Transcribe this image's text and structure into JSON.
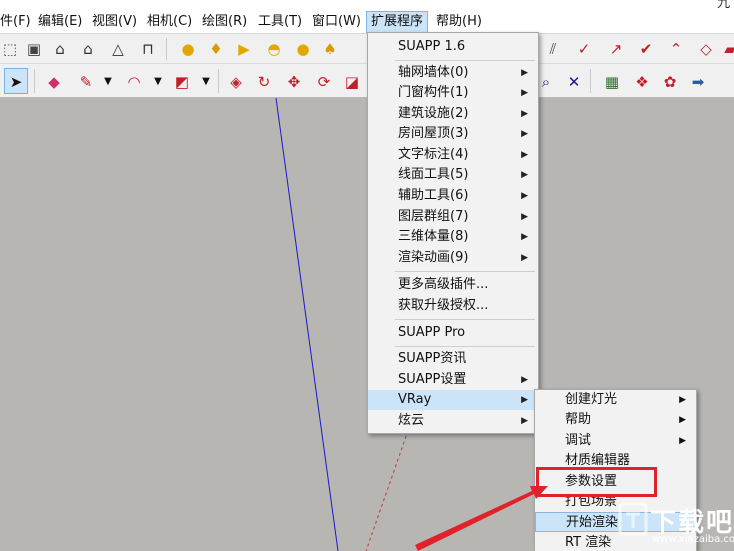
{
  "title": {
    "fragment": "九"
  },
  "menubar": {
    "items": [
      {
        "label": "件(F)"
      },
      {
        "label": "编辑(E)"
      },
      {
        "label": "视图(V)"
      },
      {
        "label": "相机(C)"
      },
      {
        "label": "绘图(R)"
      },
      {
        "label": "工具(T)"
      },
      {
        "label": "窗口(W)"
      },
      {
        "label": "扩展程序"
      },
      {
        "label": "帮助(H)"
      }
    ]
  },
  "toolbar": {
    "icons": [
      "section-icon",
      "box-icon",
      "house-icon",
      "house-outline-icon",
      "roof-icon",
      "warehouse-icon",
      "sphere-icon",
      "spotlight-icon",
      "flag-icon",
      "dome-icon",
      "ball-icon",
      "lamp-icon",
      "select-arrow-icon",
      "eraser-icon",
      "pencil-icon",
      "arc-icon",
      "shape-icon",
      "push-pull-icon",
      "orbit-icon",
      "move-icon",
      "rotate-icon",
      "scale-icon"
    ]
  },
  "extension_menu": {
    "header": "SUAPP 1.6",
    "items": [
      {
        "label": "轴网墙体(0)",
        "submenu": true
      },
      {
        "label": "门窗构件(1)",
        "submenu": true
      },
      {
        "label": "建筑设施(2)",
        "submenu": true
      },
      {
        "label": "房间屋顶(3)",
        "submenu": true
      },
      {
        "label": "文字标注(4)",
        "submenu": true
      },
      {
        "label": "线面工具(5)",
        "submenu": true
      },
      {
        "label": "辅助工具(6)",
        "submenu": true
      },
      {
        "label": "图层群组(7)",
        "submenu": true
      },
      {
        "label": "三维体量(8)",
        "submenu": true
      },
      {
        "label": "渲染动画(9)",
        "submenu": true
      }
    ],
    "more_plugins": "更多高级插件...",
    "get_license": "获取升级授权...",
    "suapp_pro": "SUAPP Pro",
    "suapp_news": "SUAPP资讯",
    "suapp_settings": "SUAPP设置",
    "vray": "VRay",
    "xuanyun": "炫云"
  },
  "vray_menu": {
    "items": [
      {
        "label": "创建灯光",
        "submenu": true
      },
      {
        "label": "帮助",
        "submenu": true
      },
      {
        "label": "调试",
        "submenu": true
      },
      {
        "label": "材质编辑器",
        "submenu": false
      },
      {
        "label": "参数设置",
        "submenu": false
      },
      {
        "label": "打包场景",
        "submenu": false
      },
      {
        "label": "开始渲染",
        "submenu": false
      },
      {
        "label": "RT 渲染",
        "submenu": false
      }
    ]
  },
  "watermark": {
    "brand": "下载吧",
    "url": "www.xiazaiba.com"
  },
  "colors": {
    "highlight": "#cce4f7",
    "callout": "#e0222a",
    "canvas": "#b8b6b3",
    "axis_blue": "#1a1acc",
    "axis_red": "#cc3333"
  }
}
